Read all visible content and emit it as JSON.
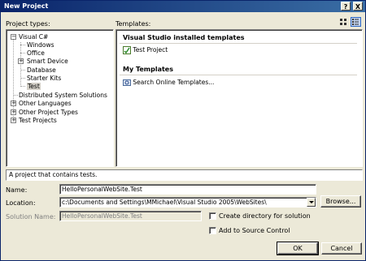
{
  "window": {
    "title": "New Project"
  },
  "title_buttons": {
    "help": "?",
    "close": "X"
  },
  "project_types_label": "Project types:",
  "templates_label": "Templates:",
  "tree": {
    "visual_csharp": "Visual C#",
    "windows": "Windows",
    "office": "Office",
    "smart_device": "Smart Device",
    "database": "Database",
    "starter_kits": "Starter Kits",
    "test": "Test",
    "distributed": "Distributed System Solutions",
    "other_languages": "Other Languages",
    "other_project_types": "Other Project Types",
    "test_projects": "Test Projects"
  },
  "templates": {
    "installed_header": "Visual Studio installed templates",
    "test_project": "Test Project",
    "my_header": "My Templates",
    "search_online": "Search Online Templates..."
  },
  "description": "A project that contains tests.",
  "form": {
    "name_label": "Name:",
    "name_value": "HelloPersonalWebSite.Test",
    "location_label": "Location:",
    "location_value": "c:\\Documents and Settings\\MMichael\\Visual Studio 2005\\WebSites\\",
    "solution_label": "Solution Name:",
    "solution_value": "HelloPersonalWebSite.Test",
    "browse": "Browse...",
    "create_dir": "Create directory for solution",
    "add_source": "Add to Source Control",
    "ok": "OK",
    "cancel": "Cancel"
  },
  "icons": [
    "help-icon",
    "close-icon",
    "large-icons-view-icon",
    "small-icons-view-icon",
    "test-project-icon",
    "search-online-icon",
    "expand-icon",
    "collapse-icon",
    "dropdown-arrow-icon"
  ]
}
